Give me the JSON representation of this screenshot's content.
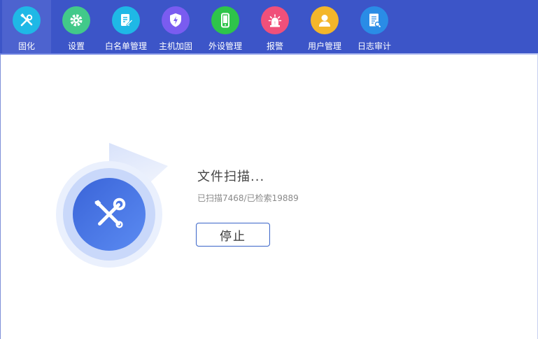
{
  "toolbar": {
    "items": [
      {
        "label": "固化",
        "icon": "tools-icon",
        "color": "#1fb8e6"
      },
      {
        "label": "设置",
        "icon": "gear-icon",
        "color": "#42c98a"
      },
      {
        "label": "白名单管理",
        "icon": "document-edit-icon",
        "color": "#1fb8e6"
      },
      {
        "label": "主机加固",
        "icon": "shield-bolt-icon",
        "color": "#7a5cf0"
      },
      {
        "label": "外设管理",
        "icon": "phone-icon",
        "color": "#2ec44a"
      },
      {
        "label": "报警",
        "icon": "alarm-siren-icon",
        "color": "#f0507a"
      },
      {
        "label": "用户管理",
        "icon": "user-icon",
        "color": "#f3b62a"
      },
      {
        "label": "日志审计",
        "icon": "log-audit-icon",
        "color": "#2a8ce6"
      }
    ]
  },
  "scan": {
    "title": "文件扫描...",
    "detail": "已扫描7468/已检索19889",
    "stop_label": "停止"
  }
}
